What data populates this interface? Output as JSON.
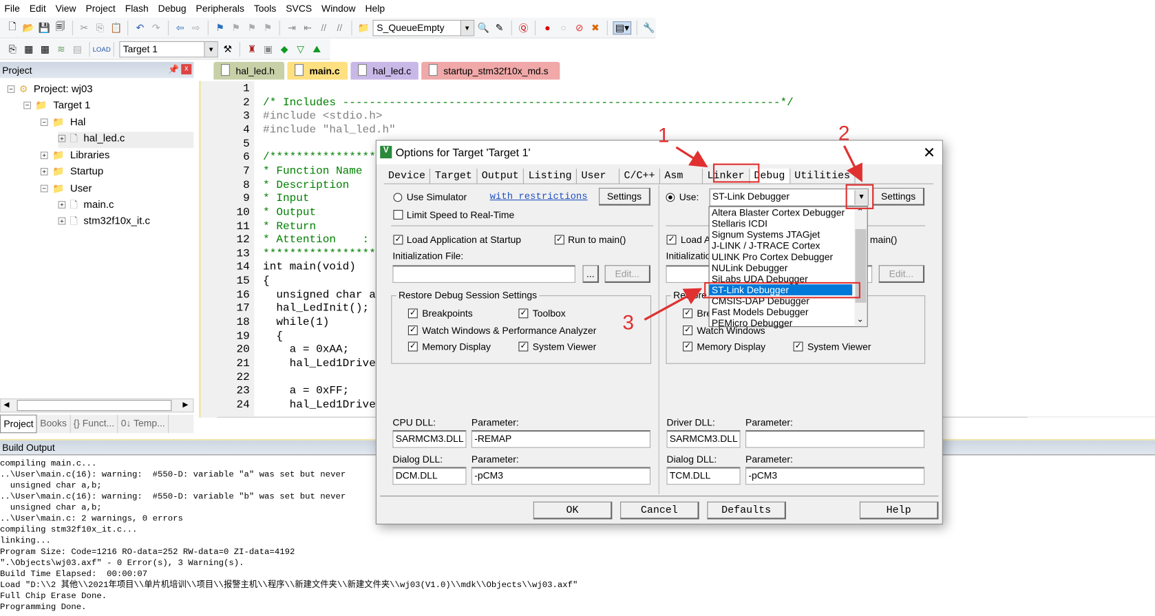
{
  "menu": [
    "File",
    "Edit",
    "View",
    "Project",
    "Flash",
    "Debug",
    "Peripherals",
    "Tools",
    "SVCS",
    "Window",
    "Help"
  ],
  "toolbar": {
    "find_combo": "S_QueueEmpty",
    "target_combo": "Target 1"
  },
  "project_panel": {
    "title": "Project",
    "tree": [
      {
        "label": "Project: wj03",
        "level": 0
      },
      {
        "label": "Target 1",
        "level": 1
      },
      {
        "label": "Hal",
        "level": 2
      },
      {
        "label": "hal_led.c",
        "level": 3
      },
      {
        "label": "Libraries",
        "level": 2
      },
      {
        "label": "Startup",
        "level": 2
      },
      {
        "label": "User",
        "level": 2
      },
      {
        "label": "main.c",
        "level": 3
      },
      {
        "label": "stm32f10x_it.c",
        "level": 3
      }
    ],
    "tabs": [
      "Project",
      "Books",
      "{} Funct...",
      "0↓ Temp..."
    ]
  },
  "editor": {
    "tabs": [
      {
        "label": "hal_led.h",
        "color": "#c8d0a8"
      },
      {
        "label": "main.c",
        "color": "#ffe080",
        "active": true
      },
      {
        "label": "hal_led.c",
        "color": "#c8b8e8"
      },
      {
        "label": "startup_stm32f10x_md.s",
        "color": "#f0a8a8"
      }
    ],
    "lines": [
      "",
      "/* Includes ------------------------------------------------------------------*/",
      "#include <stdio.h>",
      "#include \"hal_led.h\"",
      "",
      "/*******************************************",
      "* Function Name",
      "* Description",
      "* Input",
      "* Output",
      "* Return",
      "* Attention    :",
      "*******************************************",
      "int main(void)",
      "{",
      "  unsigned char a,b;",
      "  hal_LedInit();",
      "  while(1)",
      "  {",
      "    a = 0xAA;",
      "    hal_Led1Drive",
      "",
      "    a = 0xFF;",
      "    hal_Led1Drive"
    ]
  },
  "build_output": {
    "title": "Build Output",
    "lines": [
      "compiling main.c...",
      "..\\User\\main.c(16): warning:  #550-D: variable \"a\" was set but never",
      "  unsigned char a,b;",
      "..\\User\\main.c(16): warning:  #550-D: variable \"b\" was set but never",
      "  unsigned char a,b;",
      "..\\User\\main.c: 2 warnings, 0 errors",
      "compiling stm32f10x_it.c...",
      "linking...",
      "Program Size: Code=1216 RO-data=252 RW-data=0 ZI-data=4192",
      "\".\\Objects\\wj03.axf\" - 0 Error(s), 3 Warning(s).",
      "Build Time Elapsed:  00:00:07",
      "Load \"D:\\\\2 其他\\\\2021年项目\\\\单片机培训\\\\项目\\\\报警主机\\\\程序\\\\新建文件夹\\\\新建文件夹\\\\wj03(V1.0)\\\\mdk\\\\Objects\\\\wj03.axf\"",
      "Full Chip Erase Done.",
      "Programming Done."
    ]
  },
  "dialog": {
    "title": "Options for Target 'Target 1'",
    "tabs": [
      "Device",
      "Target",
      "Output",
      "Listing",
      "User",
      "C/C++",
      "Asm",
      "Linker",
      "Debug",
      "Utilities"
    ],
    "left": {
      "use_simulator": "Use Simulator",
      "restrictions_link": "with restrictions",
      "settings": "Settings",
      "limit_speed": "Limit Speed to Real-Time",
      "load_app": "Load Application at Startup",
      "run_to_main": "Run to main()",
      "init_file_label": "Initialization File:",
      "init_file": "",
      "browse": "...",
      "edit": "Edit...",
      "restore_group": "Restore Debug Session Settings",
      "breakpoints": "Breakpoints",
      "toolbox": "Toolbox",
      "watch": "Watch Windows & Performance Analyzer",
      "memory": "Memory Display",
      "sysviewer": "System Viewer",
      "cpu_dll_label": "CPU DLL:",
      "cpu_dll": "SARMCM3.DLL",
      "param_label": "Parameter:",
      "cpu_param": "-REMAP",
      "dialog_dll_label": "Dialog DLL:",
      "dialog_dll": "DCM.DLL",
      "dialog_param": "-pCM3"
    },
    "right": {
      "use": "Use:",
      "debugger": "ST-Link Debugger",
      "settings": "Settings",
      "load_app": "Load A",
      "run_to_main": "main()",
      "init_file_label": "Initializatio",
      "edit": "Edit...",
      "restore_group": "Restore",
      "breakpoints": "Bre",
      "watch": "Watch Windows",
      "memory": "Memory Display",
      "sysviewer": "System Viewer",
      "driver_dll_label": "Driver DLL:",
      "driver_dll": "SARMCM3.DLL",
      "param_label": "Parameter:",
      "driver_param": "",
      "dialog_dll_label": "Dialog DLL:",
      "dialog_dll": "TCM.DLL",
      "dialog_param": "-pCM3"
    },
    "dropdown_options": [
      "Altera Blaster Cortex Debugger",
      "Stellaris ICDI",
      "Signum Systems JTAGjet",
      "J-LINK / J-TRACE Cortex",
      "ULINK Pro Cortex Debugger",
      "NULink Debugger",
      "SiLabs UDA Debugger",
      "ST-Link Debugger",
      "CMSIS-DAP Debugger",
      "Fast Models Debugger",
      "PEMicro Debugger"
    ],
    "selected_option": "ST-Link Debugger",
    "buttons": {
      "ok": "OK",
      "cancel": "Cancel",
      "defaults": "Defaults",
      "help": "Help"
    }
  },
  "annotations": [
    "1",
    "2",
    "3"
  ],
  "colors": {
    "annotation": "#e03030",
    "selection": "#0078d7"
  }
}
